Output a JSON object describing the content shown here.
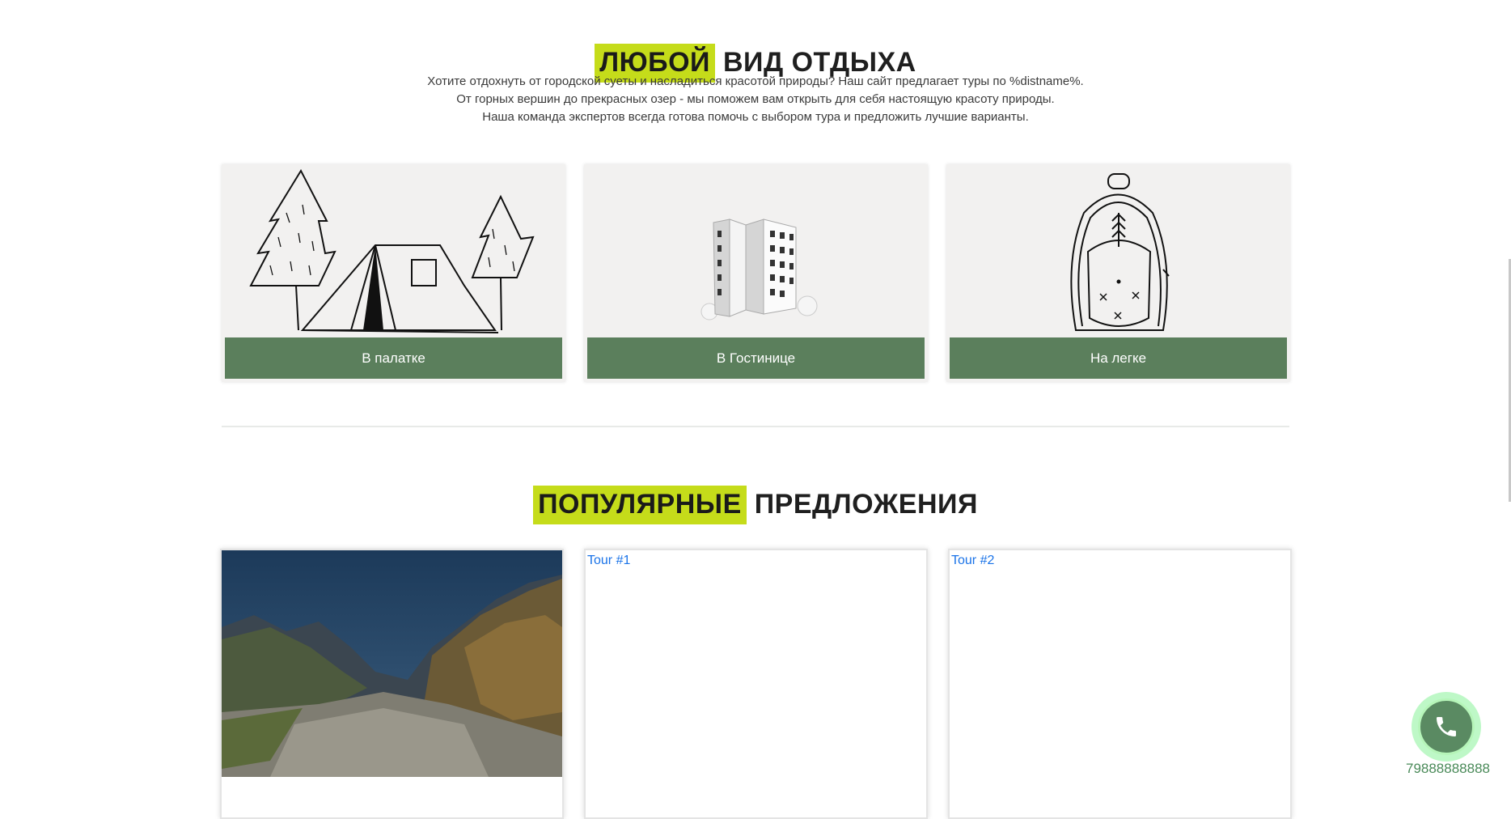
{
  "section_types": {
    "title_highlight": "ЛЮБОЙ",
    "title_rest": "ВИД ОТДЫХА",
    "intro": [
      "Хотите отдохнуть от городской суеты и насладиться красотой природы? Наш сайт предлагает туры по %distname%.",
      "От горных вершин до прекрасных озер - мы поможем вам открыть для себя настоящую красоту природы.",
      "Наша команда экспертов всегда готова помочь с выбором тура и предложить лучшие варианты."
    ],
    "cards": [
      {
        "label": "В палатке",
        "icon": "tent-icon"
      },
      {
        "label": "В Гостинице",
        "icon": "hotel-icon"
      },
      {
        "label": "На легке",
        "icon": "backpack-icon"
      }
    ]
  },
  "section_popular": {
    "title_highlight": "ПОПУЛЯРНЫЕ",
    "title_rest": "ПРЕДЛОЖЕНИЯ",
    "tours": [
      {
        "type": "image",
        "image": "mountain-river-photo"
      },
      {
        "link": "Tour #1"
      },
      {
        "link": "Tour #2"
      }
    ]
  },
  "contact": {
    "phone": "79888888888",
    "icon": "phone-icon"
  },
  "colors": {
    "accent": "#c5dc1a",
    "card_label_bg": "#5b7f5c",
    "link": "#1a73e8",
    "phone_green": "#5a8a62"
  }
}
